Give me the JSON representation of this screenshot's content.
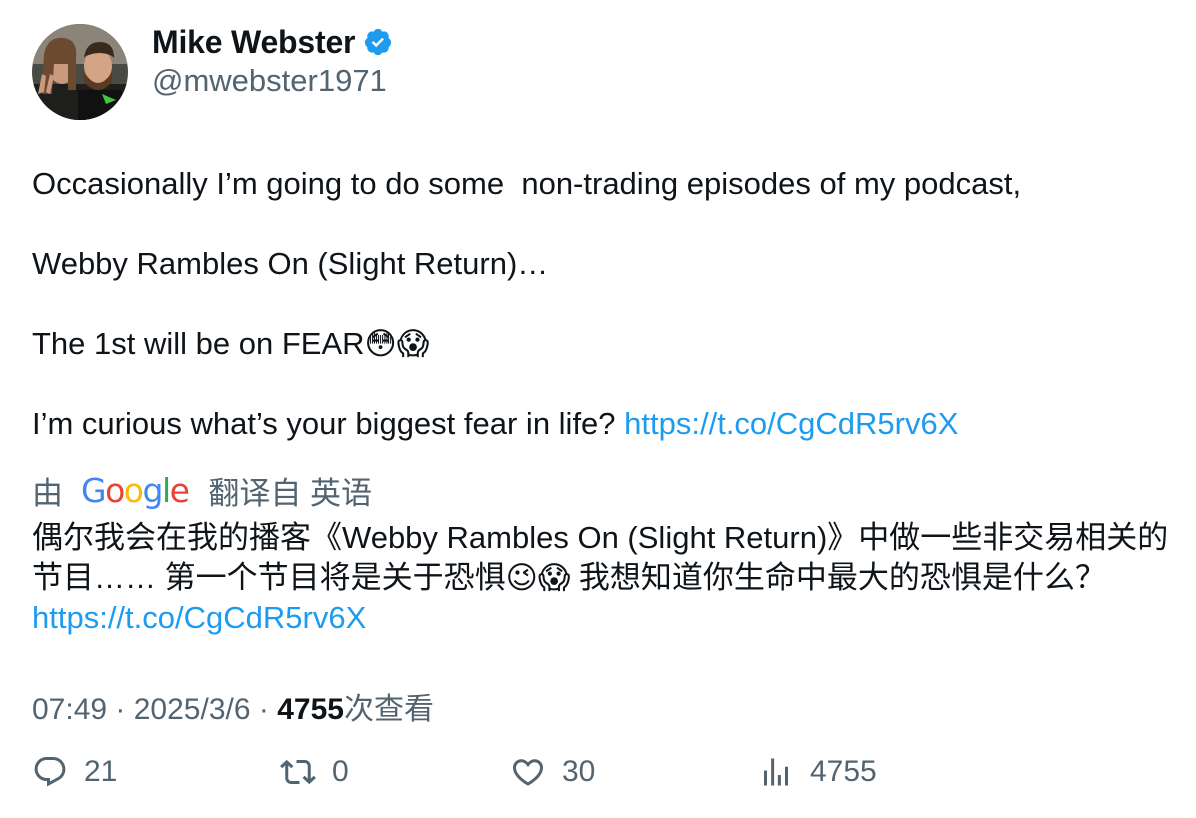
{
  "author": {
    "display_name": "Mike Webster",
    "handle": "@mwebster1971",
    "verified": true,
    "verified_icon": "verified-badge-icon",
    "accent_color": "#1d9bf0"
  },
  "tweet": {
    "line1": "Occasionally I’m going to do some  non-trading episodes of my podcast,",
    "line2": "Webby Rambles On (Slight Return)…",
    "line3": "The 1st will be on FEAR",
    "line3_emojis": "😳😱",
    "line4": "I’m curious what’s your biggest fear in life? ",
    "link": "https://t.co/CgCdR5rv6X"
  },
  "translation": {
    "prefix": "由",
    "provider": "Google",
    "suffix": "翻译自 英语",
    "text_part1": "偶尔我会在我的播客《Webby Rambles On (Slight Return)》中做一些非交易相关的节目…… 第一个节目将是关于恐惧",
    "emojis": "😉😱",
    "text_part2": " 我想知道你生命中最大的恐惧是什么？",
    "link": "https://t.co/CgCdR5rv6X"
  },
  "meta": {
    "time": "07:49",
    "sep1": " · ",
    "date": "2025/3/6",
    "sep2": " · ",
    "views": "4755",
    "views_label": "次查看"
  },
  "actions": {
    "replies": "21",
    "retweets": "0",
    "likes": "30",
    "views": "4755"
  }
}
